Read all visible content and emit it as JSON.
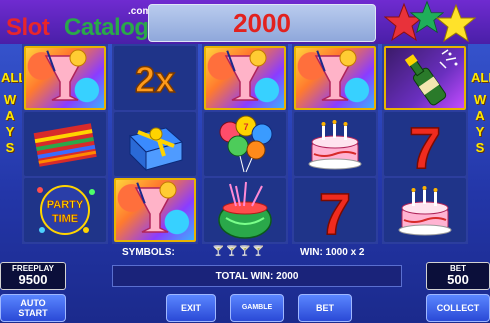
{
  "header": {
    "logo_slot": "Slot",
    "logo_catalog": "Catalog",
    "logo_domain": ".com",
    "credit_display": "2000"
  },
  "side_label": {
    "word1": "ALL",
    "word2": "WAYS"
  },
  "reels": [
    [
      "cocktail",
      "sarape",
      "party-time"
    ],
    [
      "2x",
      "gift-box",
      "cocktail"
    ],
    [
      "cocktail",
      "balloons",
      "watermelon-punch"
    ],
    [
      "cocktail",
      "birthday-cake",
      "seven"
    ],
    [
      "champagne",
      "seven",
      "birthday-cake"
    ]
  ],
  "symbol_text": {
    "multiplier": "2x",
    "party_line1": "PARTY",
    "party_line2": "TIME",
    "seven": "7"
  },
  "info": {
    "symbols_label": "SYMBOLS:",
    "win_text": "WIN: 1000 x 2",
    "total_win": "TOTAL WIN: 2000"
  },
  "freeplay": {
    "label": "FREEPLAY",
    "value": "9500"
  },
  "bet": {
    "label": "BET",
    "value": "500"
  },
  "buttons": {
    "auto_line1": "AUTO",
    "auto_line2": "START",
    "exit": "EXIT",
    "gamble": "GAMBLE",
    "bet": "BET",
    "collect": "COLLECT"
  },
  "colors": {
    "background": "#2a44b8",
    "win_highlight": "#e8b400",
    "credit_text": "#e2221f",
    "ways_text": "#ffe800"
  }
}
